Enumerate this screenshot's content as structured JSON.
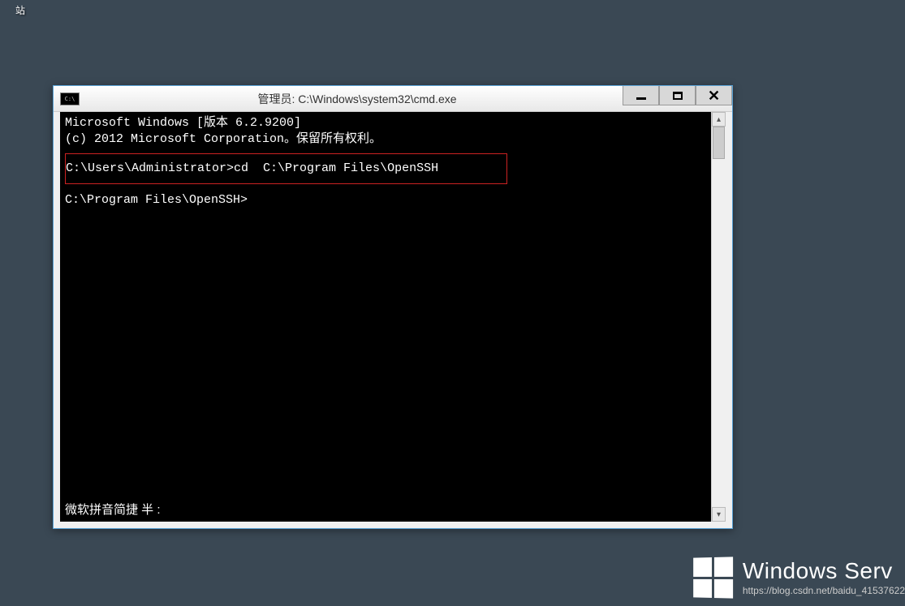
{
  "desktop": {
    "icon_label": "站"
  },
  "window": {
    "title": "管理员: C:\\Windows\\system32\\cmd.exe"
  },
  "terminal": {
    "line1": "Microsoft Windows [版本 6.2.9200]",
    "line2": "(c) 2012 Microsoft Corporation。保留所有权利。",
    "prompt1": "C:\\Users\\Administrator>cd  C:\\Program Files\\OpenSSH",
    "prompt2": "C:\\Program Files\\OpenSSH>",
    "ime_status": "微软拼音简捷 半 :"
  },
  "branding": {
    "main_text": "Windows Serv",
    "url": "https://blog.csdn.net/baidu_41537622"
  }
}
